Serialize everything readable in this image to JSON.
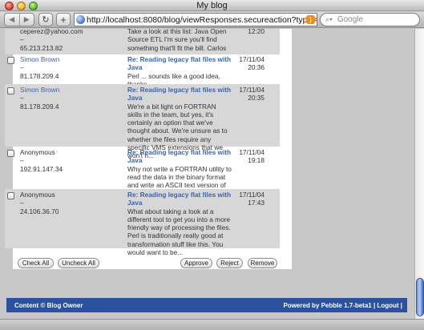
{
  "window": {
    "title": "My blog"
  },
  "toolbar": {
    "back_icon": "back-arrow-icon",
    "forward_icon": "forward-arrow-icon",
    "reload_label": "↻",
    "add_label": "+",
    "url": "http://localhost:8080/blog/viewResponses.secureaction?type=approved",
    "search_placeholder": "Google"
  },
  "responses": [
    {
      "author_lines": [
        "ceperez@yahoo.com",
        "–",
        "65.213.213.82"
      ],
      "author_is_link": false,
      "subject": "",
      "excerpt": "Take a look at this list: Java Open Source ETL I'm sure you'll find something that'll fit the bill. Carlos",
      "date": "",
      "time": "12:20",
      "shaded": true,
      "has_checkbox": false
    },
    {
      "author_lines": [
        "Simon Brown",
        "–",
        "81.178.209.4"
      ],
      "author_is_link": true,
      "subject": "Re: Reading legacy flat files with Java",
      "excerpt": "Perl ... sounds like a good idea, thanks.",
      "date": "17/11/04",
      "time": "20:36",
      "shaded": false,
      "has_checkbox": true
    },
    {
      "author_lines": [
        "Simon Brown",
        "–",
        "81.178.209.4"
      ],
      "author_is_link": true,
      "subject": "Re: Reading legacy flat files with Java",
      "excerpt": "We're a bit light on FORTRAN skills in the team, but yes, it's certainly an option that we've thought about. We're unsure as to whether the files require any specific VMS extensions that we won't h...",
      "date": "17/11/04",
      "time": "20:35",
      "shaded": true,
      "has_checkbox": true
    },
    {
      "author_lines": [
        "Anonymous",
        "–",
        "192.91.147.34"
      ],
      "author_is_link": false,
      "subject": "Re: Reading legacy flat files with Java",
      "excerpt": "Why not write a FORTRAN utility to read the data in the binary format and write an ASCII text version of it. Java can then process the text file.",
      "date": "17/11/04",
      "time": "19:18",
      "shaded": false,
      "has_checkbox": true
    },
    {
      "author_lines": [
        "Anonymous",
        "–",
        "24.106.36.70"
      ],
      "author_is_link": false,
      "subject": "Re: Reading legacy flat files with Java",
      "excerpt": "What about taking a look at a different tool to get you into a more friendly way of processing the files. Perl is traditionally really good at transformation stuff like this. You would want to be...",
      "date": "17/11/04",
      "time": "17:43",
      "shaded": true,
      "has_checkbox": true
    }
  ],
  "buttons": {
    "check_all": "Check All",
    "uncheck_all": "Uncheck All",
    "approve": "Approve",
    "reject": "Reject",
    "remove": "Remove"
  },
  "footer": {
    "left": "Content © Blog Owner",
    "right": "Powered by Pebble 1.7-beta1 | Logout |"
  },
  "colors": {
    "link": "#3c64ad",
    "footer_bg": "#2c519e",
    "row_shade": "#d7d7d7"
  }
}
